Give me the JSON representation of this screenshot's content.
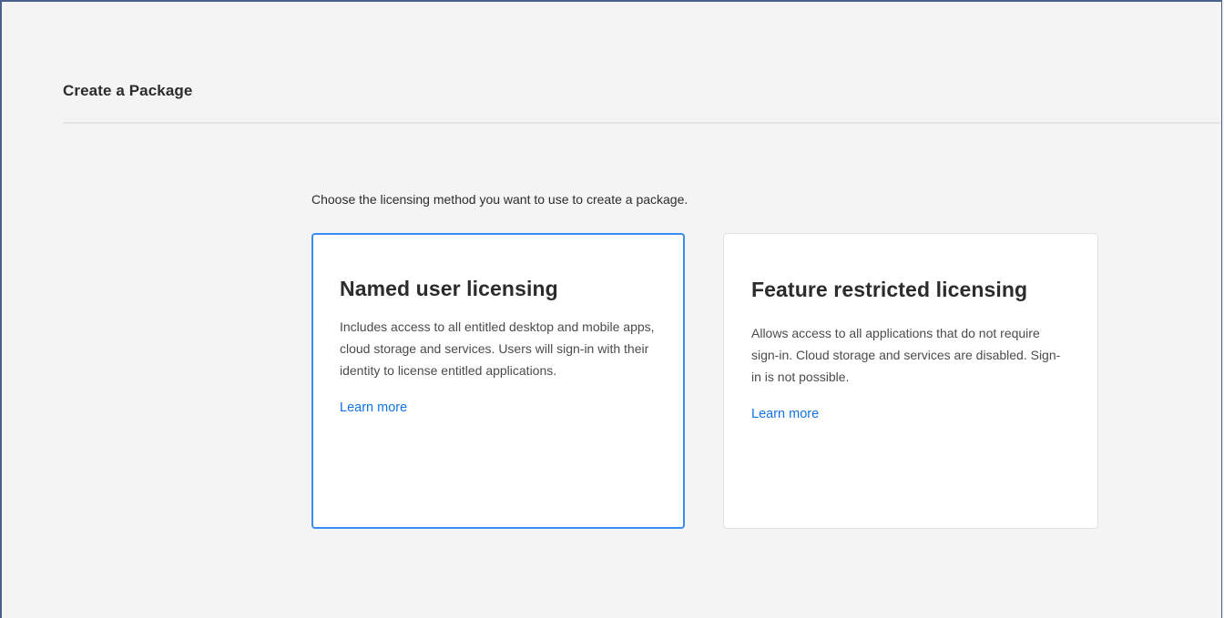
{
  "page": {
    "title": "Create a Package",
    "intro": "Choose the licensing method you want to use to create a package."
  },
  "cards": [
    {
      "title": "Named user licensing",
      "description": "Includes access to all entitled desktop and mobile apps, cloud storage and services. Users will sign-in with their identity to license entitled applications.",
      "link_label": "Learn more",
      "selected": true
    },
    {
      "title": "Feature restricted licensing",
      "description": "Allows access to all applications that do not require sign-in. Cloud storage and services are disabled. Sign-in is not possible.",
      "link_label": "Learn more",
      "selected": false
    }
  ],
  "colors": {
    "background": "#f4f4f4",
    "selected_border": "#378ef0",
    "link": "#1473e6",
    "frame_border": "#4a5f8c"
  }
}
